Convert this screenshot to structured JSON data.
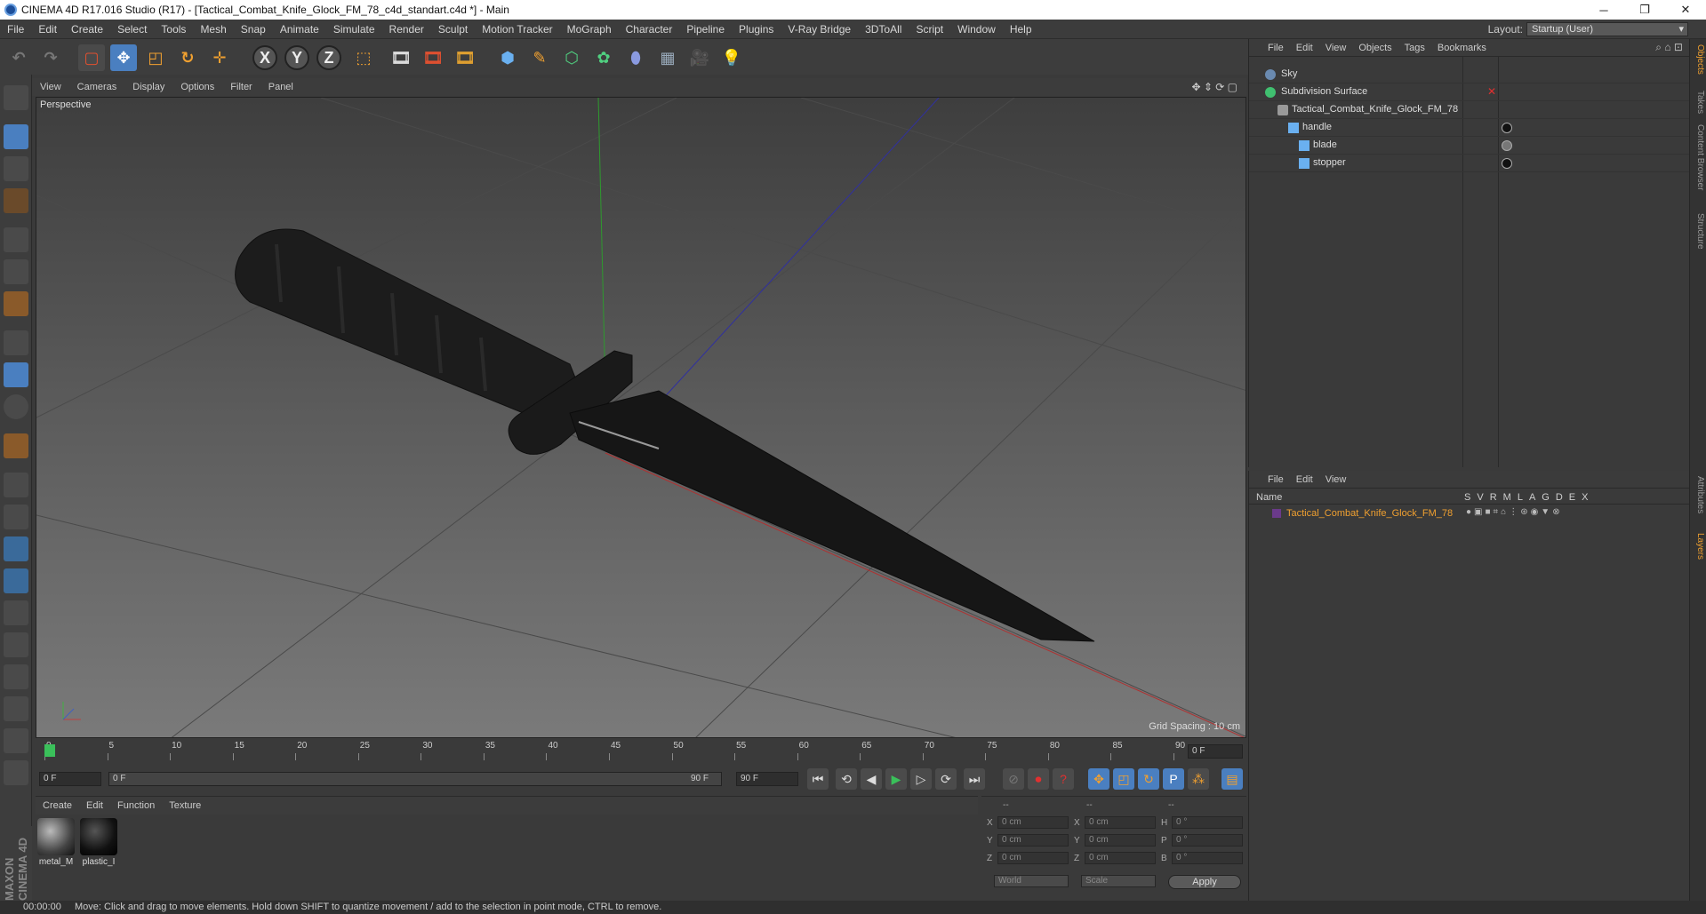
{
  "window": {
    "title": "CINEMA 4D R17.016 Studio (R17) - [Tactical_Combat_Knife_Glock_FM_78_c4d_standart.c4d *] - Main"
  },
  "menubar": {
    "items": [
      "File",
      "Edit",
      "Create",
      "Select",
      "Tools",
      "Mesh",
      "Snap",
      "Animate",
      "Simulate",
      "Render",
      "Sculpt",
      "Motion Tracker",
      "MoGraph",
      "Character",
      "Pipeline",
      "Plugins",
      "V-Ray Bridge",
      "3DToAll",
      "Script",
      "Window",
      "Help"
    ]
  },
  "layout": {
    "label": "Layout:",
    "value": "Startup (User)"
  },
  "viewport": {
    "menu": [
      "View",
      "Cameras",
      "Display",
      "Options",
      "Filter",
      "Panel"
    ],
    "label": "Perspective",
    "grid_spacing": "Grid Spacing : 10 cm"
  },
  "timeline": {
    "ticks": [
      "0",
      "5",
      "10",
      "15",
      "20",
      "25",
      "30",
      "35",
      "40",
      "45",
      "50",
      "55",
      "60",
      "65",
      "70",
      "75",
      "80",
      "85",
      "90"
    ],
    "current_frame": "0 F",
    "start_field": "0 F",
    "range_start": "0 F",
    "range_end": "90 F",
    "end_field": "90 F"
  },
  "material_panel": {
    "menu": [
      "Create",
      "Edit",
      "Function",
      "Texture"
    ],
    "materials": [
      {
        "name": "metal_M"
      },
      {
        "name": "plastic_I"
      }
    ]
  },
  "coordinates": {
    "headers": [
      "--",
      "--",
      "--"
    ],
    "rows": [
      {
        "a": "X",
        "av": "0 cm",
        "b": "X",
        "bv": "0 cm",
        "c": "H",
        "cv": "0 °"
      },
      {
        "a": "Y",
        "av": "0 cm",
        "b": "Y",
        "bv": "0 cm",
        "c": "P",
        "cv": "0 °"
      },
      {
        "a": "Z",
        "av": "0 cm",
        "b": "Z",
        "bv": "0 cm",
        "c": "B",
        "cv": "0 °"
      }
    ],
    "mode1": "World",
    "mode2": "Scale",
    "apply": "Apply"
  },
  "object_manager": {
    "menu": [
      "File",
      "Edit",
      "View",
      "Objects",
      "Tags",
      "Bookmarks"
    ],
    "objects": [
      {
        "name": "Sky"
      },
      {
        "name": "Subdivision Surface"
      },
      {
        "name": "Tactical_Combat_Knife_Glock_FM_78"
      },
      {
        "name": "handle"
      },
      {
        "name": "blade"
      },
      {
        "name": "stopper"
      }
    ]
  },
  "attribute_manager": {
    "menu": [
      "File",
      "Edit",
      "View"
    ],
    "name_header": "Name",
    "columns": [
      "S",
      "V",
      "R",
      "M",
      "L",
      "A",
      "G",
      "D",
      "E",
      "X"
    ],
    "layer_name": "Tactical_Combat_Knife_Glock_FM_78"
  },
  "side_tabs": [
    "Objects",
    "Takes",
    "Content Browser",
    "Structure",
    "Attributes",
    "Layers"
  ],
  "status": {
    "time": "00:00:00",
    "message": "Move: Click and drag to move elements. Hold down SHIFT to quantize movement / add to the selection in point mode, CTRL to remove."
  },
  "colors": {
    "accent": "#e8a030",
    "layer_text": "#f0a030",
    "select_blue": "#4a7fc0"
  }
}
